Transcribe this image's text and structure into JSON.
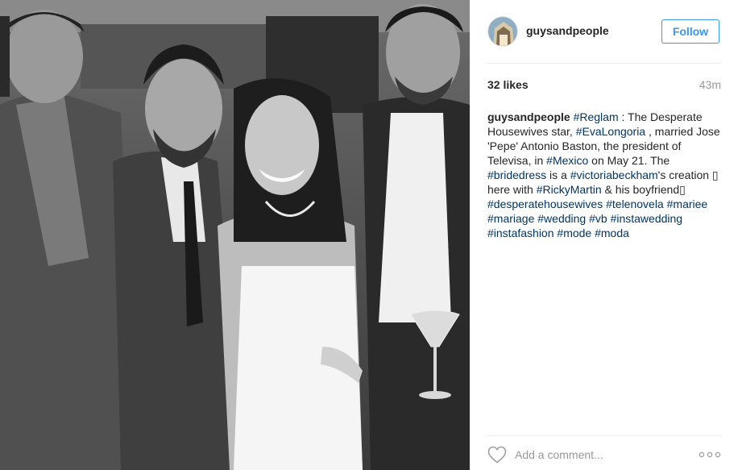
{
  "photo": {
    "alt_subject": "wedding group photo",
    "tone": "black-and-white"
  },
  "header": {
    "username": "guysandpeople",
    "follow_label": "Follow"
  },
  "stats": {
    "likes": "32 likes",
    "time_ago": "43m"
  },
  "caption": {
    "username": "guysandpeople",
    "segments": [
      {
        "text": "#Reglam",
        "tag": true
      },
      {
        "text": " : The Desperate Housewives star, ",
        "tag": false
      },
      {
        "text": "#EvaLongoria",
        "tag": true
      },
      {
        "text": " , married Jose 'Pepe' Antonio Baston, the president of Televisa, in ",
        "tag": false
      },
      {
        "text": "#Mexico",
        "tag": true
      },
      {
        "text": " on May 21. The ",
        "tag": false
      },
      {
        "text": "#bridedress",
        "tag": true
      },
      {
        "text": " is a ",
        "tag": false
      },
      {
        "text": "#victoriabeckham",
        "tag": true
      },
      {
        "text": "'s creation ▯ here with ",
        "tag": false
      },
      {
        "text": "#RickyMartin",
        "tag": true
      },
      {
        "text": " & his boyfriend▯ ",
        "tag": false
      },
      {
        "text": "#desperatehousewives",
        "tag": true
      },
      {
        "text": " ",
        "tag": false
      },
      {
        "text": "#telenovela",
        "tag": true
      },
      {
        "text": " ",
        "tag": false
      },
      {
        "text": "#mariee",
        "tag": true
      },
      {
        "text": " ",
        "tag": false
      },
      {
        "text": "#mariage",
        "tag": true
      },
      {
        "text": " ",
        "tag": false
      },
      {
        "text": "#wedding",
        "tag": true
      },
      {
        "text": " ",
        "tag": false
      },
      {
        "text": "#vb",
        "tag": true
      },
      {
        "text": " ",
        "tag": false
      },
      {
        "text": "#instawedding",
        "tag": true
      },
      {
        "text": " ",
        "tag": false
      },
      {
        "text": "#instafashion",
        "tag": true
      },
      {
        "text": " ",
        "tag": false
      },
      {
        "text": "#mode",
        "tag": true
      },
      {
        "text": " ",
        "tag": false
      },
      {
        "text": "#moda",
        "tag": true
      }
    ]
  },
  "footer": {
    "comment_placeholder": "Add a comment...",
    "like_icon": "heart-icon",
    "more_icon": "more-options-icon"
  },
  "colors": {
    "link": "#003569",
    "follow": "#3897f0",
    "muted": "#999999",
    "divider": "#efefef"
  }
}
